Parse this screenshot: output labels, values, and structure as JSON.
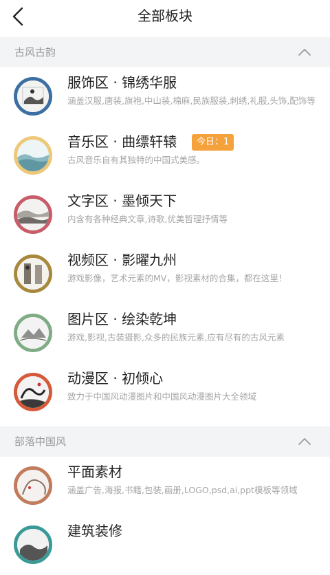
{
  "header": {
    "title": "全部板块",
    "back_icon": "back-arrow-icon"
  },
  "sections": [
    {
      "title": "古风古韵",
      "boards": [
        {
          "name": "服饰区 · 锦绣华服",
          "desc": "涵盖汉服,唐装,旗袍,中山装,棉麻,民族服装,刺绣,礼服,头饰,配饰等",
          "ring_color": "#3c6fa2",
          "icon": "painting-thumbnail-icon"
        },
        {
          "name": "音乐区 · 曲缥轩辕",
          "desc": "古风音乐自有其独特的中国式美感。",
          "ring_color": "#ecc878",
          "icon": "painting-thumbnail-icon",
          "badge": "今日：1",
          "badge_color": "#f5a23c"
        },
        {
          "name": "文字区 · 墨倾天下",
          "desc": "内含有各种经典文章,诗歌,优美哲理抒情等",
          "ring_color": "#c85c68",
          "icon": "painting-thumbnail-icon"
        },
        {
          "name": "视频区 · 影曜九州",
          "desc": "游戏影像，艺术元素的MV，影视素材的合集，都在这里！",
          "ring_color": "#a8883c",
          "icon": "painting-thumbnail-icon"
        },
        {
          "name": "图片区 · 绘染乾坤",
          "desc": "游戏,影视,古装摄影,众多的民族元素,应有尽有的古风元素",
          "ring_color": "#7fac84",
          "icon": "painting-thumbnail-icon"
        },
        {
          "name": "动漫区 · 初倾心",
          "desc": "致力于中国风动漫图片和中国风动漫图片大全领域",
          "ring_color": "#d65a3a",
          "icon": "painting-thumbnail-icon"
        }
      ]
    },
    {
      "title": "部落中国风",
      "boards": [
        {
          "name": "平面素材",
          "desc": "涵盖广告,海报,书籍,包装,画册,LOGO,psd,ai,ppt模板等领域",
          "ring_color": "#c07c5c",
          "icon": "painting-thumbnail-icon"
        },
        {
          "name": "建筑装修",
          "desc": "",
          "ring_color": "#3a9a98",
          "icon": "painting-thumbnail-icon"
        }
      ]
    }
  ],
  "collapse_icon": "chevron-up-icon"
}
